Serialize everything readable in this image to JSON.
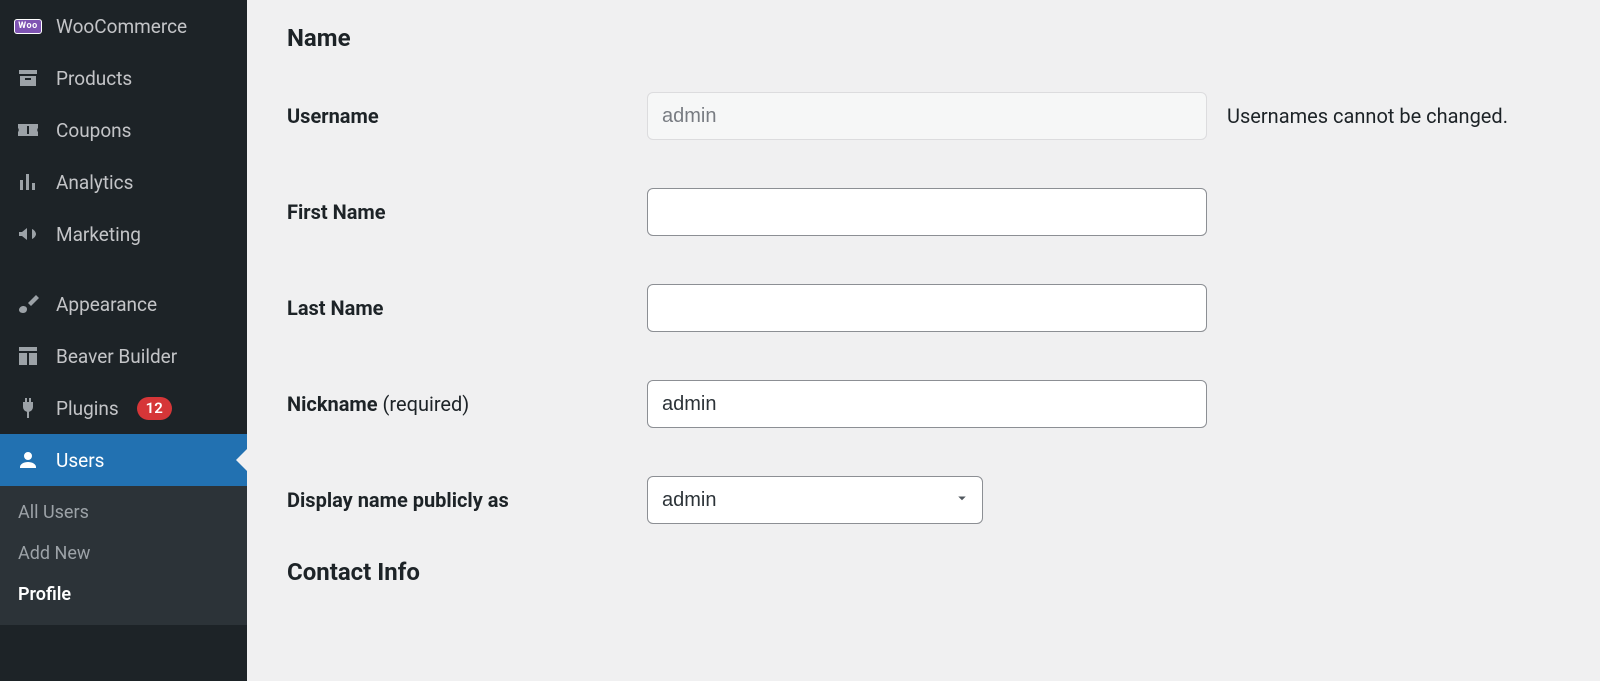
{
  "sidebar": {
    "items": [
      {
        "label": "WooCommerce"
      },
      {
        "label": "Products"
      },
      {
        "label": "Coupons"
      },
      {
        "label": "Analytics"
      },
      {
        "label": "Marketing"
      },
      {
        "label": "Appearance"
      },
      {
        "label": "Beaver Builder"
      },
      {
        "label": "Plugins",
        "badge": "12"
      },
      {
        "label": "Users"
      }
    ],
    "submenu": [
      {
        "label": "All Users"
      },
      {
        "label": "Add New"
      },
      {
        "label": "Profile"
      }
    ]
  },
  "form": {
    "section_name": "Name",
    "section_contact": "Contact Info",
    "username_label": "Username",
    "username_value": "admin",
    "username_hint": "Usernames cannot be changed.",
    "firstname_label": "First Name",
    "firstname_value": "",
    "lastname_label": "Last Name",
    "lastname_value": "",
    "nickname_label": "Nickname",
    "nickname_req": "(required)",
    "nickname_value": "admin",
    "displayname_label": "Display name publicly as",
    "displayname_value": "admin"
  }
}
